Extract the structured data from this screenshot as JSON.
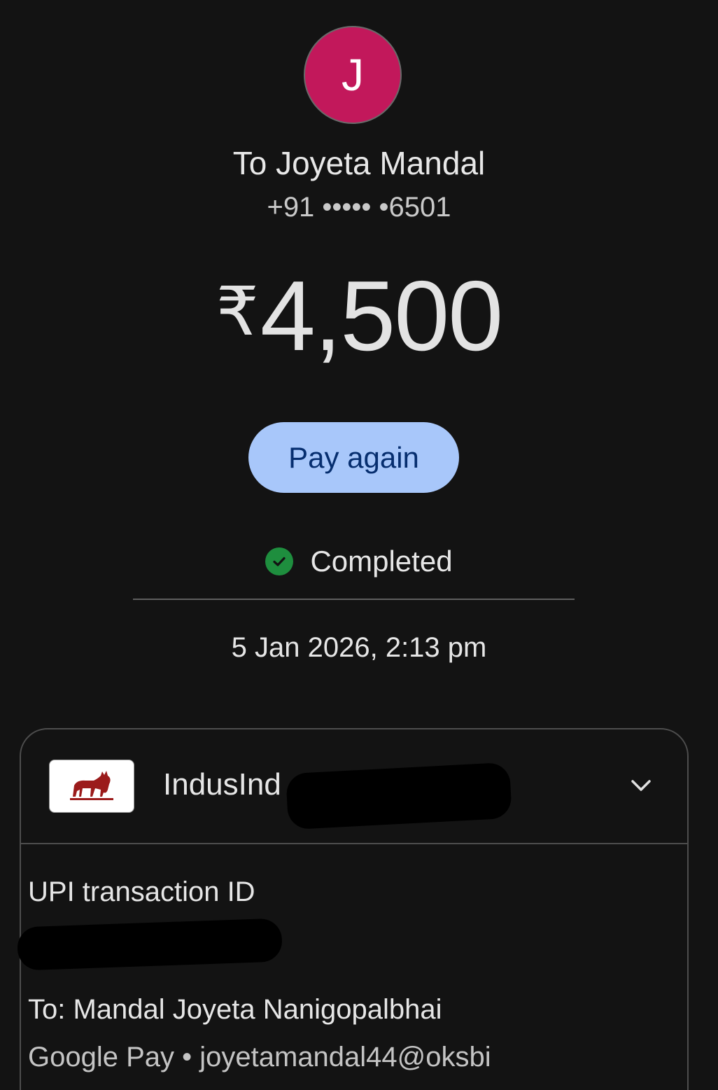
{
  "recipient": {
    "avatar_initial": "J",
    "title": "To Joyeta Mandal",
    "phone": "+91 ••••• •6501"
  },
  "payment": {
    "currency_symbol": "₹",
    "amount": "4,500",
    "pay_again_label": "Pay again",
    "status": "Completed",
    "datetime": "5 Jan 2026, 2:13 pm"
  },
  "details": {
    "bank_name": "IndusInd",
    "bank_logo_icon": "bull-logo-icon",
    "expand_icon": "chevron-down-icon",
    "upi_label": "UPI transaction ID",
    "to_line": "To: Mandal Joyeta Nanigopalbhai",
    "sub_line": "Google Pay • joyetamandal44@oksbi"
  },
  "colors": {
    "background": "#131313",
    "avatar": "#c2185b",
    "pay_button": "#a8c7fa",
    "pay_button_text": "#062e6f",
    "status_icon": "#1e8e3e"
  }
}
